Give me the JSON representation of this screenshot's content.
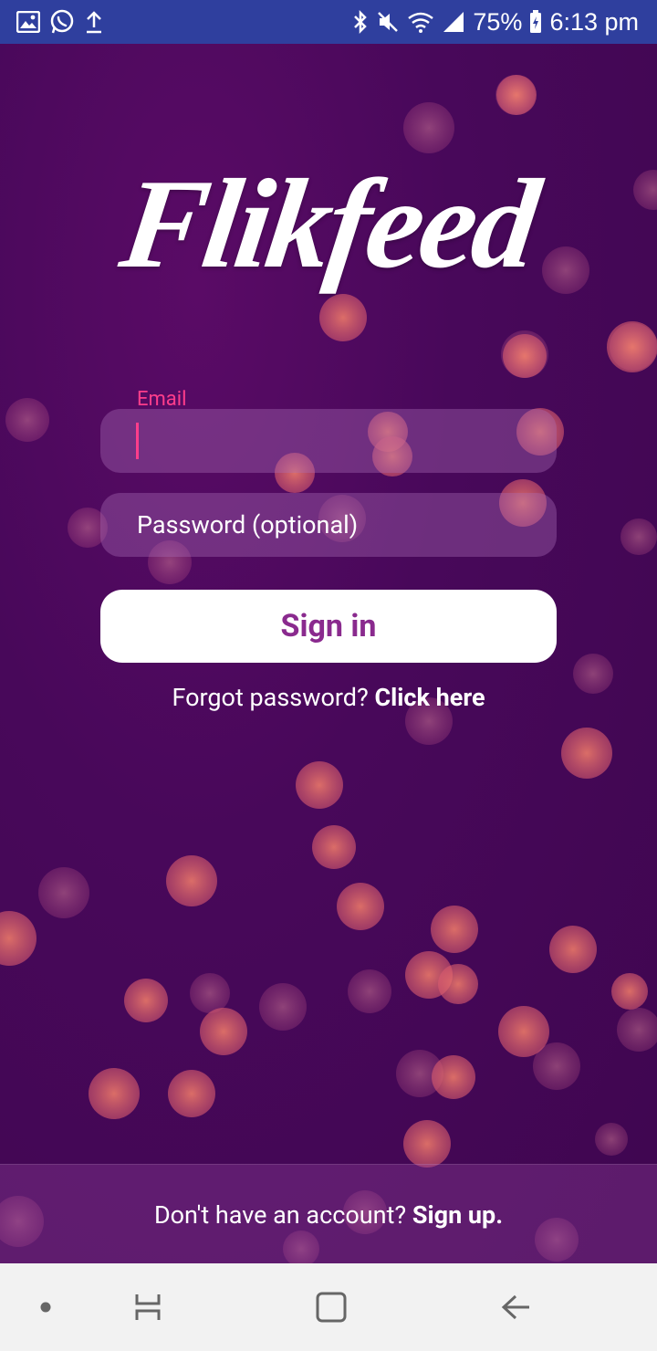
{
  "status_bar": {
    "battery": "75%",
    "time": "6:13 pm",
    "left_icons": [
      "gallery-icon",
      "whatsapp-icon",
      "upload-icon"
    ],
    "right_icons": [
      "bluetooth-icon",
      "mute-icon",
      "wifi-icon",
      "signal-icon",
      "battery-icon"
    ]
  },
  "app": {
    "logo_text": "Flikfeed",
    "email": {
      "label": "Email",
      "value": ""
    },
    "password": {
      "placeholder": "Password (optional)"
    },
    "sign_in_label": "Sign in",
    "forgot": {
      "text": "Forgot password?",
      "link": "Click here"
    },
    "footer": {
      "text": "Don't have an account?",
      "link": "Sign up."
    }
  },
  "colors": {
    "status_bar": "#2f3f9e",
    "background": "#4a0a55",
    "accent_pink": "#ff3d8b",
    "button_text": "#8a2a8e"
  },
  "nav_bar": {
    "buttons": [
      "dot-icon",
      "recent-apps-icon",
      "home-icon",
      "back-icon"
    ]
  }
}
